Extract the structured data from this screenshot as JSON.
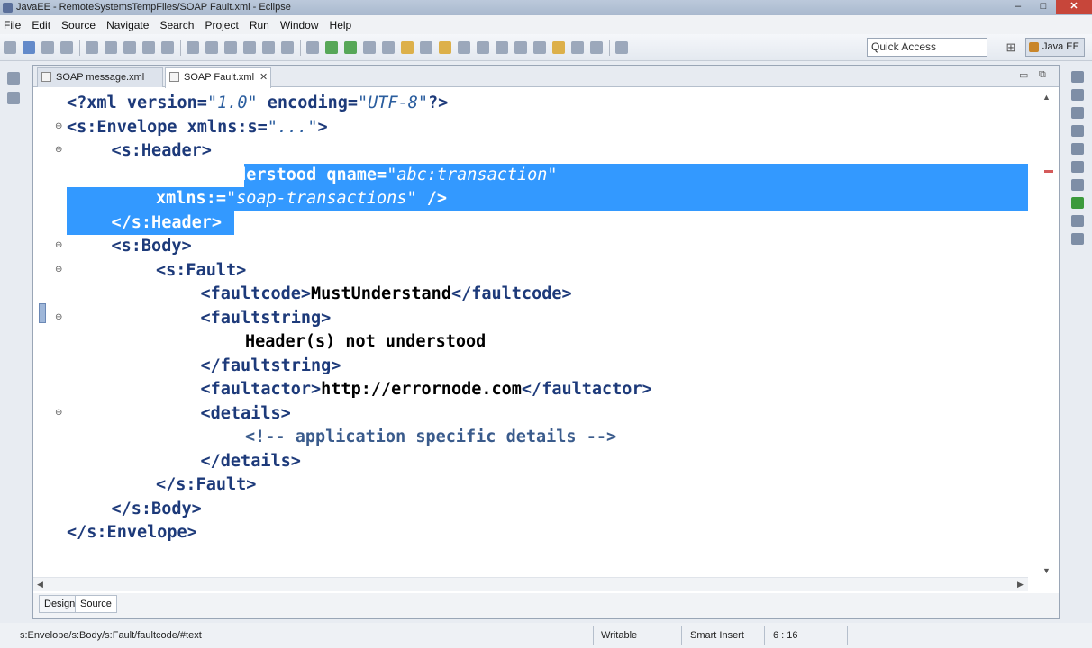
{
  "window": {
    "title": "JavaEE - RemoteSystemsTempFiles/SOAP Fault.xml - Eclipse",
    "minimize": "–",
    "maximize": "□",
    "close": "✕"
  },
  "menu": [
    "File",
    "Edit",
    "Source",
    "Navigate",
    "Search",
    "Project",
    "Run",
    "Window",
    "Help"
  ],
  "toolbar": {
    "quick_access_placeholder": "Quick Access",
    "perspective_label": "Java EE"
  },
  "tabs": [
    {
      "label": "SOAP message.xml",
      "active": false
    },
    {
      "label": "SOAP Fault.xml",
      "active": true,
      "close": "✕"
    }
  ],
  "editor": {
    "lines": [
      {
        "indent": 0,
        "parts": [
          [
            "tag",
            "<?xml "
          ],
          [
            "attr",
            "version="
          ],
          [
            "val",
            "\"1.0\""
          ],
          [
            "attr",
            " encoding="
          ],
          [
            "val",
            "\"UTF-8\""
          ],
          [
            "tag",
            "?>"
          ]
        ]
      },
      {
        "indent": 0,
        "fold": true,
        "parts": [
          [
            "tag",
            "<s:Envelope "
          ],
          [
            "attr",
            "xmlns:s="
          ],
          [
            "val",
            "\"...\""
          ],
          [
            "tag",
            ">"
          ]
        ]
      },
      {
        "indent": 1,
        "fold": true,
        "parts": [
          [
            "tag",
            "<s:Header>"
          ]
        ]
      },
      {
        "indent": 2,
        "selected": true,
        "parts": [
          [
            "tag",
            "<f:Misunderstood "
          ],
          [
            "attr",
            "qname="
          ],
          [
            "val",
            "\"abc:transaction\""
          ]
        ]
      },
      {
        "indent": 2,
        "selected": true,
        "parts": [
          [
            "attr",
            "xmlns:="
          ],
          [
            "val",
            "\"soap-transactions\""
          ],
          [
            "tag",
            " />"
          ]
        ]
      },
      {
        "indent": 1,
        "selected": true,
        "parts": [
          [
            "tag",
            "</s:Header>"
          ]
        ]
      },
      {
        "indent": 1,
        "fold": true,
        "parts": [
          [
            "tag",
            "<s:Body>"
          ]
        ]
      },
      {
        "indent": 2,
        "fold": true,
        "parts": [
          [
            "tag",
            "<s:Fault>"
          ]
        ]
      },
      {
        "indent": 3,
        "parts": [
          [
            "tag",
            "<faultcode>"
          ],
          [
            "txt",
            "MustUnderstand"
          ],
          [
            "tag",
            "</faultcode>"
          ]
        ]
      },
      {
        "indent": 3,
        "fold": true,
        "parts": [
          [
            "tag",
            "<faultstring>"
          ]
        ]
      },
      {
        "indent": 4,
        "parts": [
          [
            "txt",
            "Header(s) not understood"
          ]
        ]
      },
      {
        "indent": 3,
        "parts": [
          [
            "tag",
            "</faultstring>"
          ]
        ]
      },
      {
        "indent": 3,
        "parts": [
          [
            "tag",
            "<faultactor>"
          ],
          [
            "txt",
            "http://errornode.com"
          ],
          [
            "tag",
            "</faultactor>"
          ]
        ]
      },
      {
        "indent": 3,
        "fold": true,
        "parts": [
          [
            "tag",
            "<details>"
          ]
        ]
      },
      {
        "indent": 4,
        "parts": [
          [
            "cmt",
            "<!-- application specific details -->"
          ]
        ]
      },
      {
        "indent": 3,
        "parts": [
          [
            "tag",
            "</details>"
          ]
        ]
      },
      {
        "indent": 2,
        "parts": [
          [
            "tag",
            "</s:Fault>"
          ]
        ]
      },
      {
        "indent": 1,
        "parts": [
          [
            "tag",
            "</s:Body>"
          ]
        ]
      },
      {
        "indent": 0,
        "parts": [
          [
            "tag",
            "</s:Envelope>"
          ]
        ]
      }
    ]
  },
  "editor_modes": {
    "design": "Design",
    "source": "Source"
  },
  "status": {
    "path": "s:Envelope/s:Body/s:Fault/faultcode/#text",
    "writable": "Writable",
    "insert_mode": "Smart Insert",
    "position": "6 : 16"
  },
  "icons": {
    "fold": "⊖",
    "scroll_up": "▲",
    "scroll_down": "▼",
    "scroll_left": "◀",
    "scroll_right": "▶",
    "minimize_view": "▭",
    "maximize_view": "⧉",
    "open_perspective": "⊞"
  },
  "colors": {
    "selection": "#3399ff",
    "tag": "#1d3a7a",
    "value": "#2a5d9e"
  }
}
